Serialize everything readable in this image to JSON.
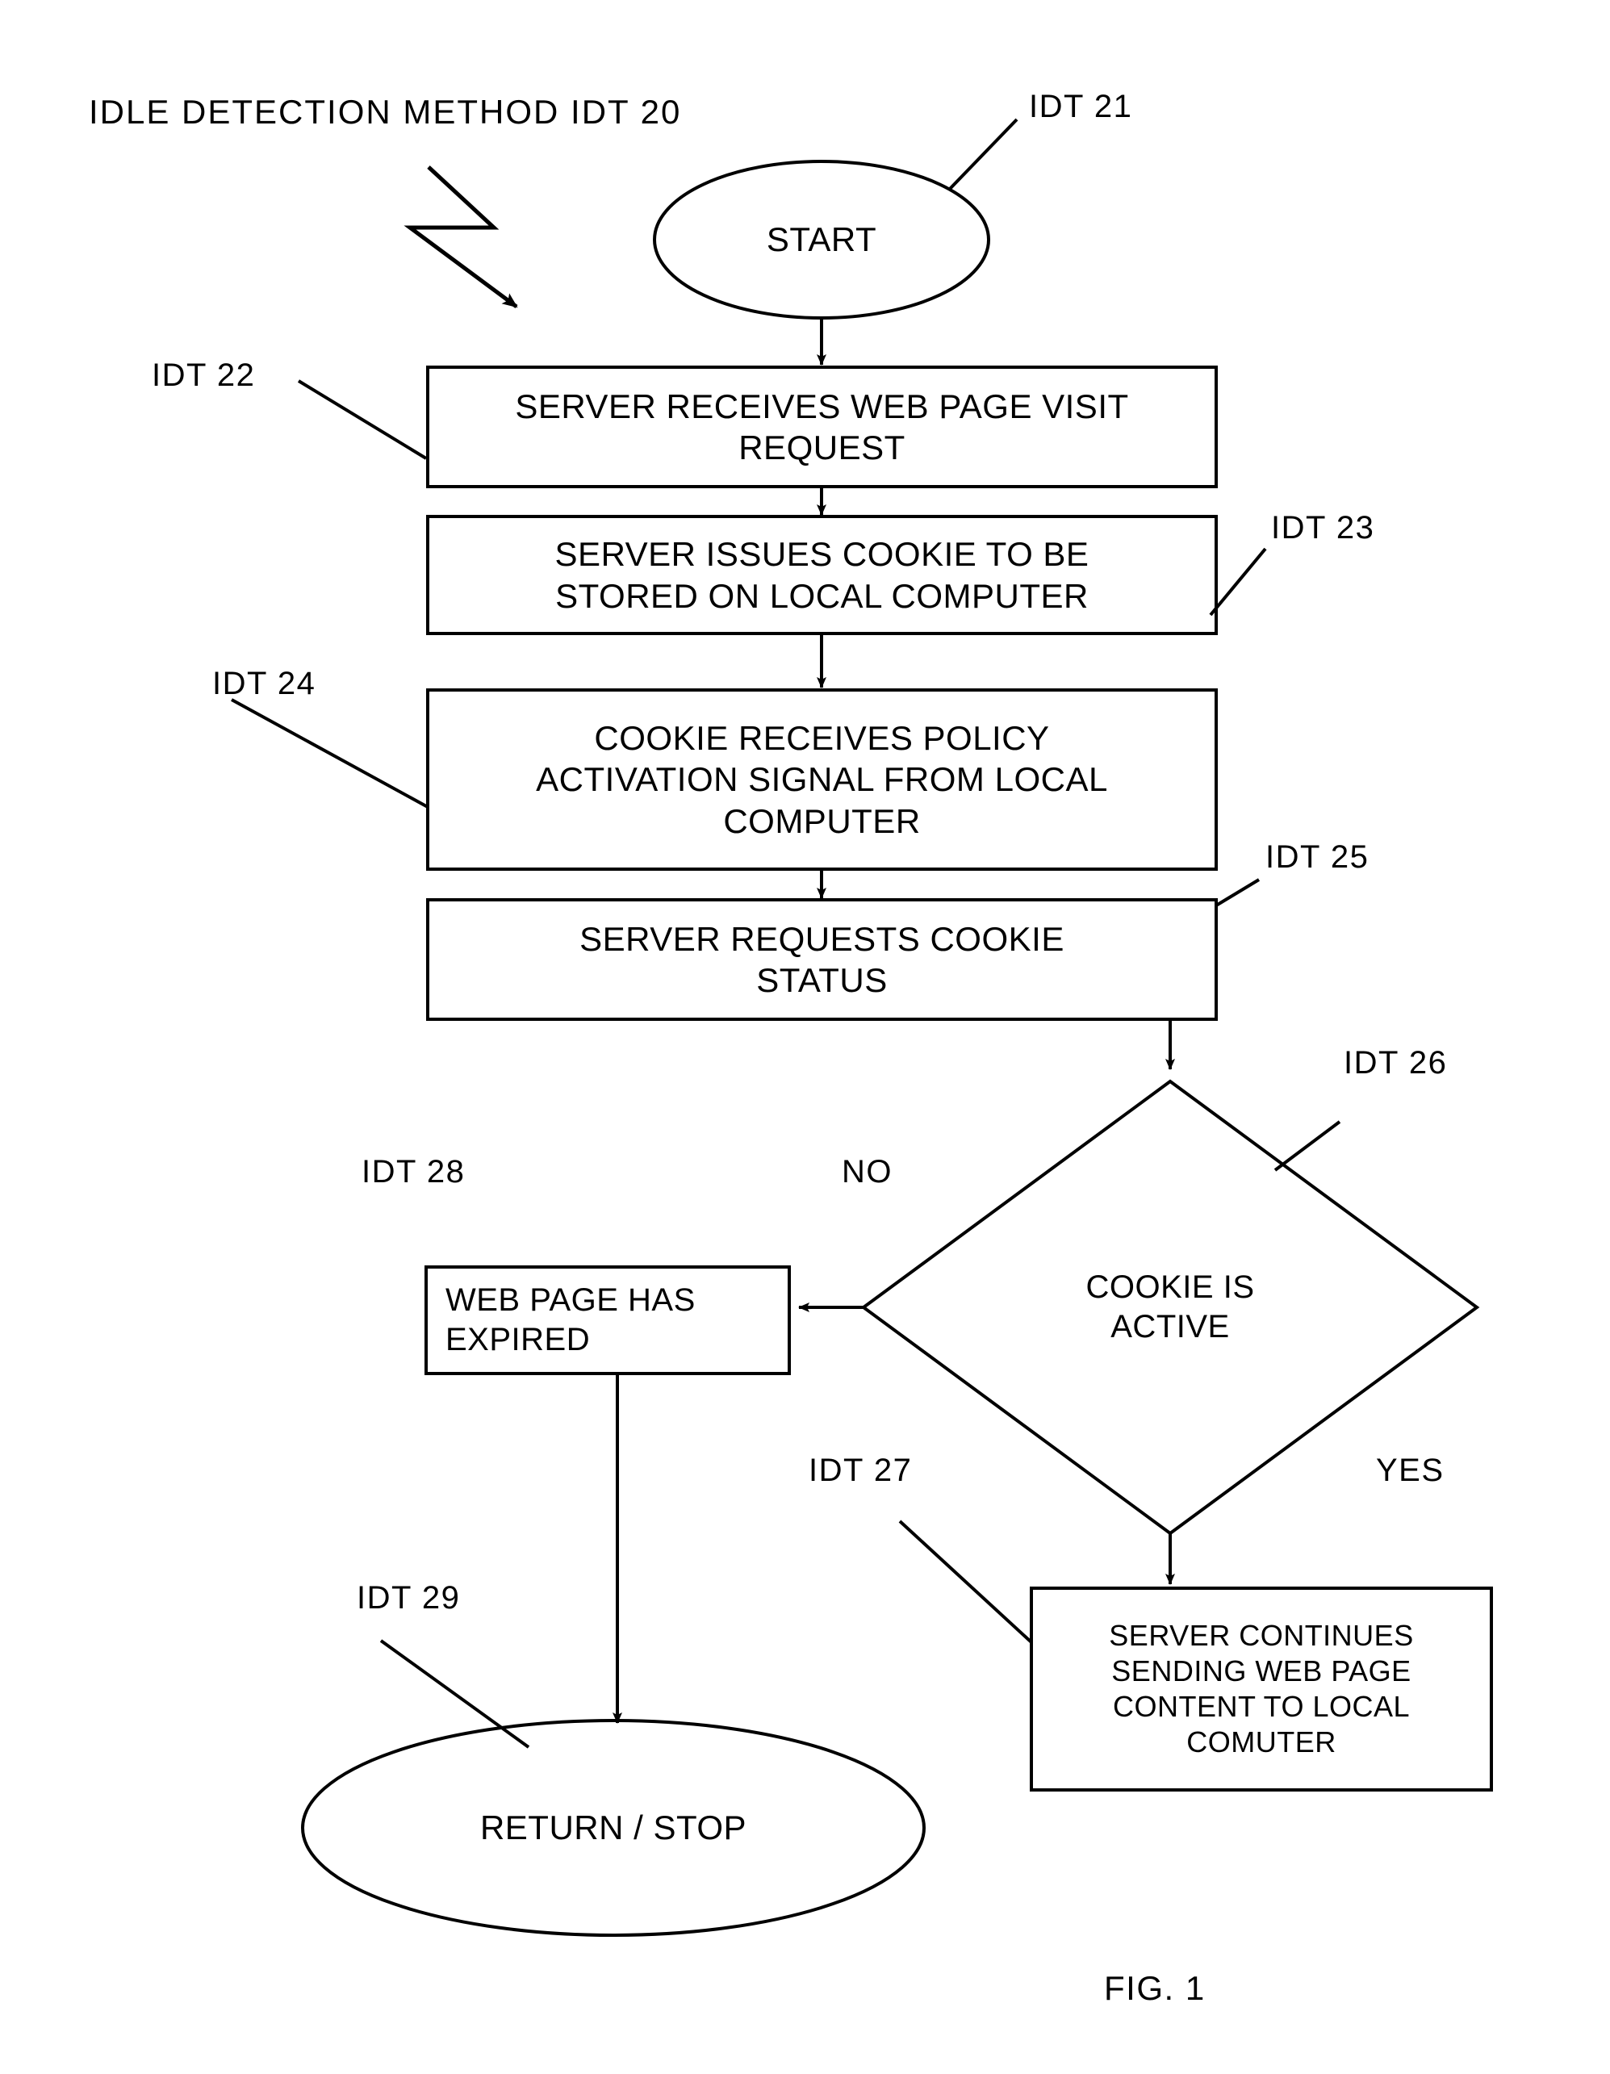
{
  "figure": {
    "title": "IDLE  DETECTION  METHOD IDT 20",
    "caption": "FIG. 1",
    "ink_color": "#000000",
    "background_color": "#ffffff"
  },
  "nodes": {
    "start": {
      "ref": "IDT 21",
      "label": "START",
      "shape": "ellipse"
    },
    "receive_request": {
      "ref": "IDT 22",
      "label": "SERVER RECEIVES WEB PAGE VISIT\nREQUEST",
      "shape": "process"
    },
    "issue_cookie": {
      "ref": "IDT  23",
      "label": "SERVER ISSUES COOKIE TO BE\nSTORED ON LOCAL COMPUTER",
      "shape": "process"
    },
    "policy_signal": {
      "ref": "IDT  24",
      "label": "COOKIE RECEIVES POLICY\nACTIVATION SIGNAL FROM LOCAL\nCOMPUTER",
      "shape": "process"
    },
    "request_status": {
      "ref": "IDT  25",
      "label": "SERVER REQUESTS COOKIE\nSTATUS",
      "shape": "process"
    },
    "decision": {
      "ref": "IDT  26",
      "label": "COOKIE IS\nACTIVE",
      "shape": "diamond"
    },
    "continue_sending": {
      "ref": "IDT  27",
      "label": "SERVER CONTINUES\nSENDING WEB PAGE\nCONTENT TO LOCAL\nCOMUTER",
      "shape": "process"
    },
    "expired": {
      "ref": "IDT  28",
      "label": "WEB PAGE HAS\nEXPIRED",
      "shape": "process"
    },
    "stop": {
      "ref": "IDT  29",
      "label": "RETURN / STOP",
      "shape": "ellipse"
    }
  },
  "branches": {
    "no": "NO",
    "yes": "YES"
  }
}
